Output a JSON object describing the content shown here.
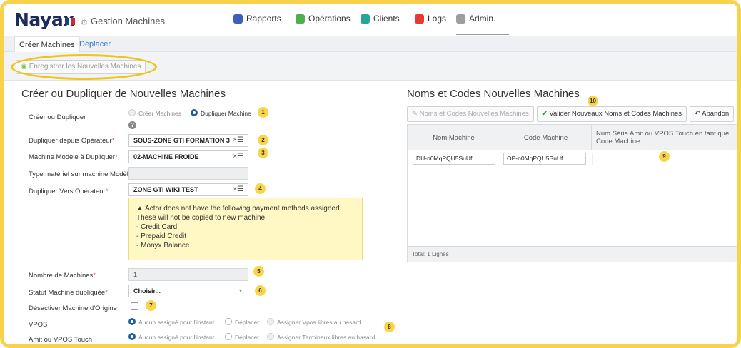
{
  "header": {
    "logo": "Nayax",
    "app_title": "Gestion Machines",
    "nav": [
      {
        "label": "Rapports",
        "icon": "reports-icon",
        "color": "#3d5fbf"
      },
      {
        "label": "Opérations",
        "icon": "operations-icon",
        "color": "#4caf50"
      },
      {
        "label": "Clients",
        "icon": "clients-icon",
        "color": "#26a69a"
      },
      {
        "label": "Logs",
        "icon": "logs-icon",
        "color": "#e53935"
      },
      {
        "label": "Admin.",
        "icon": "admin-icon",
        "color": "#9e9e9e"
      }
    ]
  },
  "subtabs": {
    "create": "Créer Machines",
    "move": "Déplacer"
  },
  "toolbar": {
    "save_label": "Enregistrer les Nouvelles Machines"
  },
  "left": {
    "title": "Créer ou Dupliquer de Nouvelles Machines",
    "labels": {
      "create_or_duplicate": "Créer ou Dupliquer",
      "from_operator": "Dupliquer depuis Opérateur",
      "model_machine": "Machine Modèle à Dupliquer",
      "hardware_type": "Type matériel sur machine Modèle :",
      "to_operator": "Dupliquer Vers Opérateur",
      "machine_count": "Nombre de Machines",
      "duplicated_status": "Statut Machine dupliquée",
      "deactivate_origin": "Désactiver Machine d'Origine",
      "vpos": "VPOS",
      "amit_vpos_touch": "Amit ou VPOS Touch"
    },
    "required_mark": "*",
    "create_options": {
      "create": "Créer Machines",
      "duplicate": "Dupliquer Machine"
    },
    "values": {
      "from_operator": "SOUS-ZONE GTI FORMATION 3",
      "model_machine": "02-MACHINE FROIDE",
      "hardware_type": "",
      "to_operator": "ZONE GTI WIKI TEST",
      "machine_count": "1",
      "duplicated_status": "Choisir..."
    },
    "clear_glyph": "×☰",
    "warning": {
      "icon_glyph": "▲",
      "line1": "Actor does not have the following payment methods assigned.",
      "line2": "These will not be copied to new machine:",
      "items": [
        "- Credit Card",
        "- Prepaid Credit",
        "- Monyx Balance"
      ]
    },
    "vpos_options": [
      "Aucun assigné pour l'instant",
      "Déplacer",
      "Assigner Vpos libres au hasard"
    ],
    "touch_options": [
      "Aucun assigné pour l'instant",
      "Déplacer",
      "Assigner Terminaux libres au hasard"
    ]
  },
  "right": {
    "title": "Noms et Codes Nouvelles Machines",
    "buttons": {
      "names_codes": "Noms et Codes Nouvelles Machines",
      "validate": "Valider Nouveaux Noms et Codes Machines",
      "cancel": "Abandon"
    },
    "columns": [
      "Nom Machine",
      "Code Machine",
      "Num Série Amit ou VPOS Touch en tant que Code Machine"
    ],
    "row": {
      "name": "DU-n0MqPQU5SuUf",
      "code": "OP-n0MqPQU5SuUf",
      "serial": ""
    },
    "footer": "Total: 1 Lignes"
  },
  "badges": [
    "1",
    "2",
    "3",
    "4",
    "5",
    "6",
    "7",
    "8",
    "9",
    "10"
  ],
  "colors": {
    "highlight": "#f0c419",
    "badge": "#f9d54a",
    "link": "#3b7cc4"
  }
}
